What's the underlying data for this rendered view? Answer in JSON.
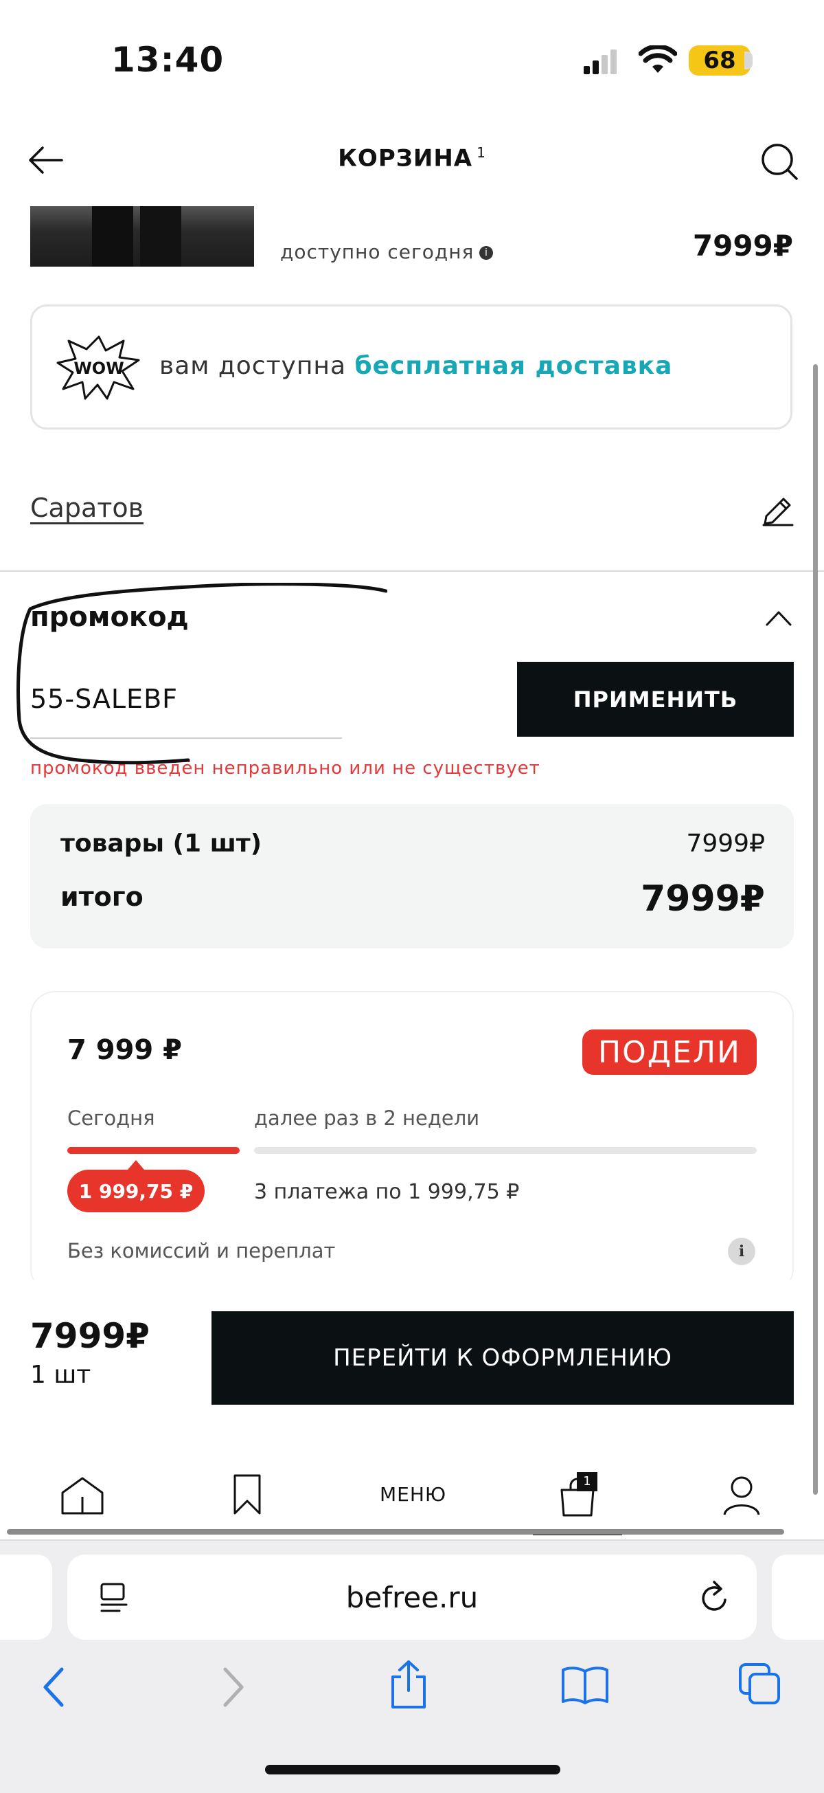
{
  "status_bar": {
    "time": "13:40",
    "battery": "68"
  },
  "header": {
    "title": "КОРЗИНА",
    "count": "1"
  },
  "product": {
    "availability": "доступно сегодня",
    "info_icon": "i",
    "price": "7999₽"
  },
  "delivery": {
    "icon_text": "WOW",
    "text": "вам доступна",
    "accent_text": "бесплатная доставка",
    "accent_color": "#17a7b5"
  },
  "city": {
    "name": "Саратов"
  },
  "promo": {
    "title": "промокод",
    "value": "55-SALEBF",
    "apply_label": "ПРИМЕНИТЬ",
    "error": "промокод введён неправильно или не существует",
    "error_color": "#e23a3a"
  },
  "summary": {
    "items_label": "товары (1 шт)",
    "items_value": "7999₽",
    "total_label": "итого",
    "total_value": "7999₽"
  },
  "podeli": {
    "price": "7 999 ₽",
    "logo": "ПОДЕЛИ",
    "today_label": "Сегодня",
    "next_label": "далее раз в 2 недели",
    "first_payment": "1 999,75 ₽",
    "payments_text": "3 платежа по 1 999,75 ₽",
    "no_fee": "Без комиссий и переплат",
    "info_icon": "i",
    "brand_color": "#e8352b"
  },
  "checkout": {
    "total": "7999₽",
    "qty": "1 шт",
    "button_label": "ПЕРЕЙТИ К ОФОРМЛЕНИЮ"
  },
  "bottom_nav": {
    "items": [
      {
        "name": "home-icon"
      },
      {
        "name": "bookmark-icon"
      },
      {
        "label": "МЕНЮ"
      },
      {
        "name": "cart-icon",
        "badge": "1"
      },
      {
        "name": "profile-icon"
      }
    ]
  },
  "browser": {
    "url": "befree.ru"
  }
}
